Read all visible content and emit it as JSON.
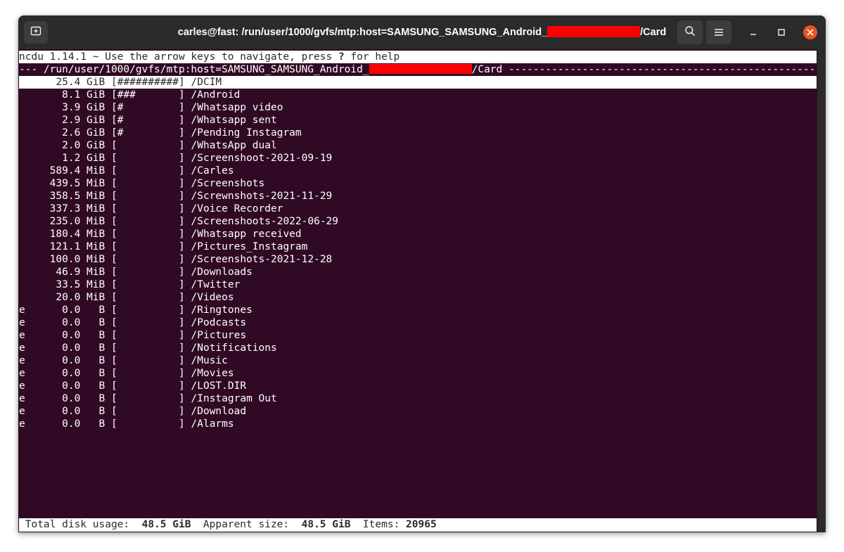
{
  "window": {
    "title_prefix": "carles@fast: /run/user/1000/gvfs/mtp:host=SAMSUNG_SAMSUNG_Android_",
    "title_suffix": "/Card"
  },
  "ncdu": {
    "header_before": "ncdu 1.14.1 ~ Use the arrow keys to navigate, press ",
    "header_key": "?",
    "header_after": " for help",
    "path_prefix": "--- /run/user/1000/gvfs/mtp:host=SAMSUNG_SAMSUNG_Android_",
    "path_suffix": "/Card ---------------------------------------------------",
    "rows": [
      {
        "flag": " ",
        "size": "25.4",
        "unit": "GiB",
        "bar": "##########",
        "name": "/DCIM",
        "selected": true
      },
      {
        "flag": " ",
        "size": "8.1",
        "unit": "GiB",
        "bar": "###       ",
        "name": "/Android"
      },
      {
        "flag": " ",
        "size": "3.9",
        "unit": "GiB",
        "bar": "#         ",
        "name": "/Whatsapp video"
      },
      {
        "flag": " ",
        "size": "2.9",
        "unit": "GiB",
        "bar": "#         ",
        "name": "/Whatsapp sent"
      },
      {
        "flag": " ",
        "size": "2.6",
        "unit": "GiB",
        "bar": "#         ",
        "name": "/Pending Instagram"
      },
      {
        "flag": " ",
        "size": "2.0",
        "unit": "GiB",
        "bar": "          ",
        "name": "/WhatsApp dual"
      },
      {
        "flag": " ",
        "size": "1.2",
        "unit": "GiB",
        "bar": "          ",
        "name": "/Screenshoot-2021-09-19"
      },
      {
        "flag": " ",
        "size": "589.4",
        "unit": "MiB",
        "bar": "          ",
        "name": "/Carles"
      },
      {
        "flag": " ",
        "size": "439.5",
        "unit": "MiB",
        "bar": "          ",
        "name": "/Screenshots"
      },
      {
        "flag": " ",
        "size": "358.5",
        "unit": "MiB",
        "bar": "          ",
        "name": "/Screwnshots-2021-11-29"
      },
      {
        "flag": " ",
        "size": "337.3",
        "unit": "MiB",
        "bar": "          ",
        "name": "/Voice Recorder"
      },
      {
        "flag": " ",
        "size": "235.0",
        "unit": "MiB",
        "bar": "          ",
        "name": "/Screenshoots-2022-06-29"
      },
      {
        "flag": " ",
        "size": "180.4",
        "unit": "MiB",
        "bar": "          ",
        "name": "/Whatsapp received"
      },
      {
        "flag": " ",
        "size": "121.1",
        "unit": "MiB",
        "bar": "          ",
        "name": "/Pictures_Instagram"
      },
      {
        "flag": " ",
        "size": "100.0",
        "unit": "MiB",
        "bar": "          ",
        "name": "/Screenshots-2021-12-28"
      },
      {
        "flag": " ",
        "size": "46.9",
        "unit": "MiB",
        "bar": "          ",
        "name": "/Downloads"
      },
      {
        "flag": " ",
        "size": "33.5",
        "unit": "MiB",
        "bar": "          ",
        "name": "/Twitter"
      },
      {
        "flag": " ",
        "size": "20.0",
        "unit": "MiB",
        "bar": "          ",
        "name": "/Videos"
      },
      {
        "flag": "e",
        "size": "0.0",
        "unit": "B",
        "bar": "          ",
        "name": "/Ringtones"
      },
      {
        "flag": "e",
        "size": "0.0",
        "unit": "B",
        "bar": "          ",
        "name": "/Podcasts"
      },
      {
        "flag": "e",
        "size": "0.0",
        "unit": "B",
        "bar": "          ",
        "name": "/Pictures"
      },
      {
        "flag": "e",
        "size": "0.0",
        "unit": "B",
        "bar": "          ",
        "name": "/Notifications"
      },
      {
        "flag": "e",
        "size": "0.0",
        "unit": "B",
        "bar": "          ",
        "name": "/Music"
      },
      {
        "flag": "e",
        "size": "0.0",
        "unit": "B",
        "bar": "          ",
        "name": "/Movies"
      },
      {
        "flag": "e",
        "size": "0.0",
        "unit": "B",
        "bar": "          ",
        "name": "/LOST.DIR"
      },
      {
        "flag": "e",
        "size": "0.0",
        "unit": "B",
        "bar": "          ",
        "name": "/Instagram Out"
      },
      {
        "flag": "e",
        "size": "0.0",
        "unit": "B",
        "bar": "          ",
        "name": "/Download"
      },
      {
        "flag": "e",
        "size": "0.0",
        "unit": "B",
        "bar": "          ",
        "name": "/Alarms"
      }
    ],
    "footer": {
      "total_label": "Total disk usage:",
      "total_value": "48.5 GiB",
      "apparent_label": "Apparent size:",
      "apparent_value": "48.5 GiB",
      "items_label": "Items:",
      "items_value": "20965"
    }
  },
  "colors": {
    "terminal_bg": "#300a24",
    "titlebar_bg": "#2b2b2b",
    "redaction": "#ff0000",
    "close_button": "#e9541f"
  },
  "icons": [
    "new-tab-icon",
    "search-icon",
    "hamburger-menu-icon",
    "minimize-icon",
    "maximize-icon",
    "close-icon"
  ]
}
